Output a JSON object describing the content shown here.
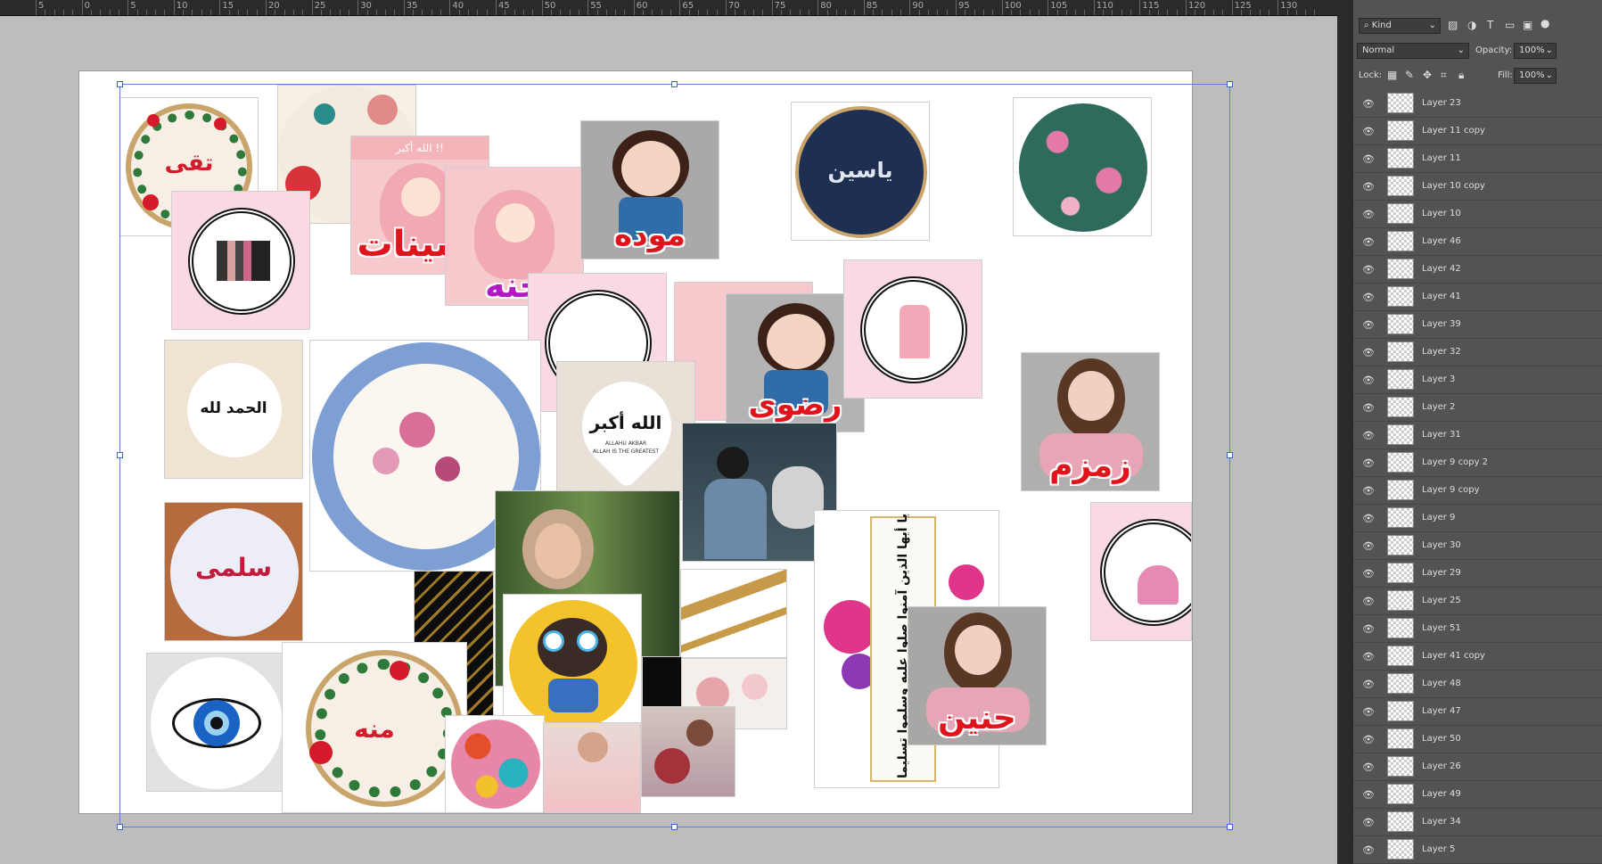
{
  "ruler": {
    "labels": [
      "5",
      "0",
      "5",
      "10",
      "15",
      "20",
      "25",
      "30",
      "35",
      "40",
      "45",
      "50",
      "55",
      "60",
      "65",
      "70",
      "75",
      "80",
      "85",
      "90",
      "95",
      "100",
      "105",
      "110",
      "115",
      "120",
      "125",
      "130"
    ]
  },
  "canvas": {
    "tiles": {
      "tuqa": "تقى",
      "asinat": "اسينات",
      "jana": "جنه",
      "mawada": "موده",
      "yasin": "ياسين",
      "radwa": "رضوى",
      "zamzam": "زمزم",
      "alhamdulillah": "الحمد لله",
      "allahu_akbar": "الله أكبر",
      "allah_sub": "ALLAHU AKBAR",
      "allah_sub2": "ALLAH IS THE GREATEST",
      "salma": "سلمى",
      "mena": "منه",
      "hanin": "حنين",
      "verse": "يا أيها الذين آمنوا صلوا عليه وسلموا تسليما",
      "banner_small": "الله أكبر !!"
    }
  },
  "toolbar": {
    "kind_label": "Kind",
    "blend_mode": "Normal",
    "opacity_label": "Opacity:",
    "opacity_value": "100%",
    "lock_label": "Lock:",
    "fill_label": "Fill:",
    "fill_value": "100%"
  },
  "layers": [
    "Layer 23",
    "Layer 11 copy",
    "Layer 11",
    "Layer 10 copy",
    "Layer 10",
    "Layer 46",
    "Layer 42",
    "Layer 41",
    "Layer 39",
    "Layer 32",
    "Layer 3",
    "Layer 2",
    "Layer 31",
    "Layer 9 copy 2",
    "Layer 9 copy",
    "Layer 9",
    "Layer 30",
    "Layer 29",
    "Layer 25",
    "Layer 51",
    "Layer 41 copy",
    "Layer 48",
    "Layer 47",
    "Layer 50",
    "Layer 26",
    "Layer 49",
    "Layer 34",
    "Layer 5"
  ],
  "colors": {
    "accent_red": "#e0141c",
    "accent_purple": "#b01ac2",
    "panel_bg": "#535353",
    "selection_blue": "#5a7fd6"
  }
}
